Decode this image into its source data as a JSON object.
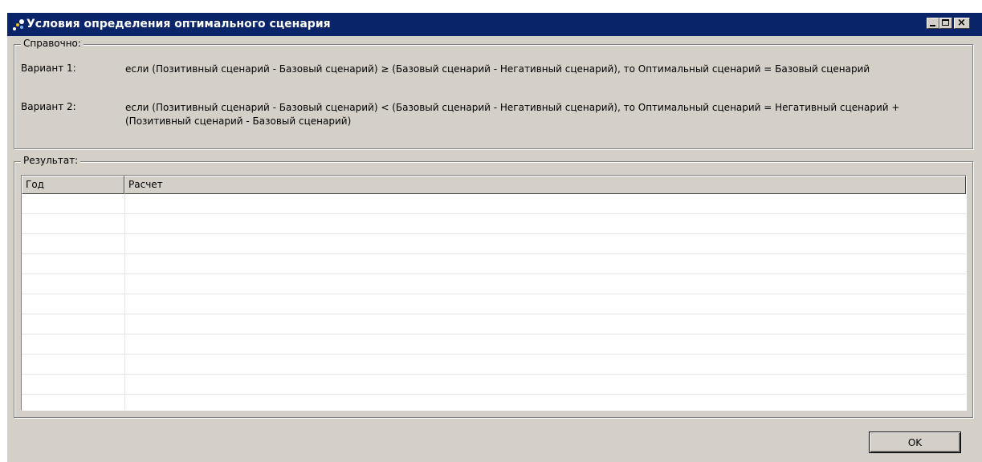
{
  "window": {
    "title": "Условия определения оптимального сценария",
    "colors": {
      "titlebar": "#0a246a",
      "face": "#d4d0c8"
    }
  },
  "reference": {
    "group_label": "Справочно:",
    "variants": [
      {
        "label": "Вариант 1:",
        "text": "если (Позитивный сценарий - Базовый сценарий) ≥ (Базовый сценарий - Негативный сценарий), то Оптимальный сценарий = Базовый сценарий"
      },
      {
        "label": "Вариант 2:",
        "text": "если (Позитивный сценарий - Базовый сценарий) < (Базовый сценарий - Негативный сценарий), то Оптимальный сценарий = Негативный сценарий + (Позитивный сценарий - Базовый сценарий)"
      }
    ]
  },
  "result": {
    "group_label": "Результат:",
    "columns": [
      "Год",
      "Расчет"
    ],
    "rows": []
  },
  "buttons": {
    "ok_label": "OK"
  }
}
